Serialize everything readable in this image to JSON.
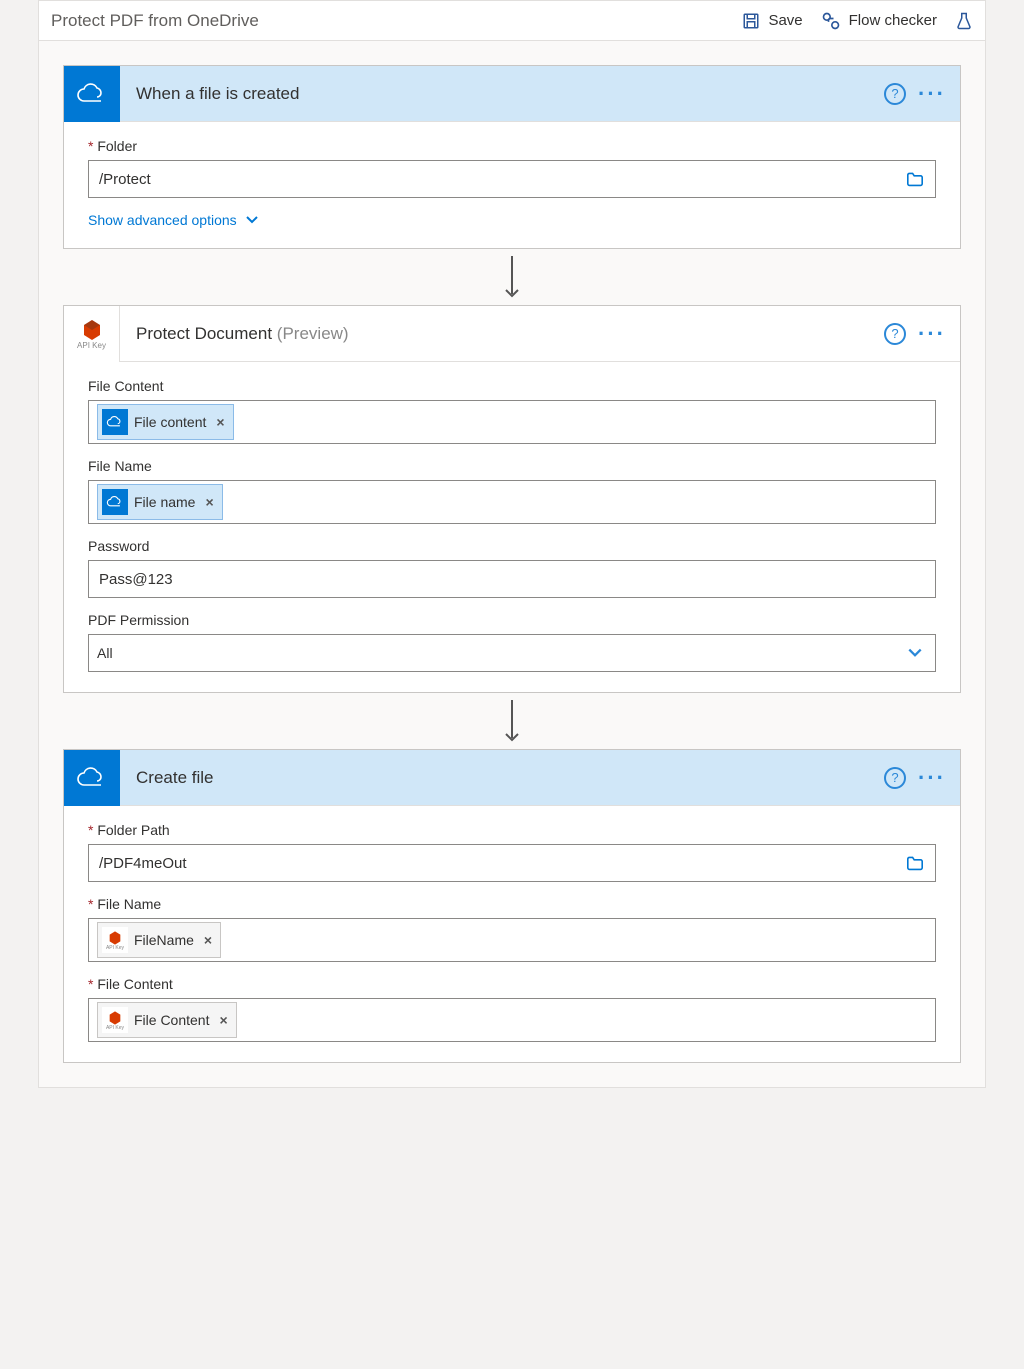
{
  "header": {
    "title": "Protect PDF from OneDrive",
    "save_label": "Save",
    "flowchecker_label": "Flow checker"
  },
  "step1": {
    "title": "When a file is created",
    "folder_label": "Folder",
    "folder_value": "/Protect",
    "show_advanced": "Show advanced options"
  },
  "step2": {
    "title": "Protect Document",
    "preview": "(Preview)",
    "api_label": "API Key",
    "filecontent_label": "File Content",
    "filecontent_token": "File content",
    "filename_label": "File Name",
    "filename_token": "File name",
    "password_label": "Password",
    "password_value": "Pass@123",
    "permission_label": "PDF Permission",
    "permission_value": "All"
  },
  "step3": {
    "title": "Create file",
    "folder_label": "Folder Path",
    "folder_value": "/PDF4meOut",
    "filename_label": "File Name",
    "filename_token": "FileName",
    "filecontent_label": "File Content",
    "filecontent_token": "File Content"
  }
}
